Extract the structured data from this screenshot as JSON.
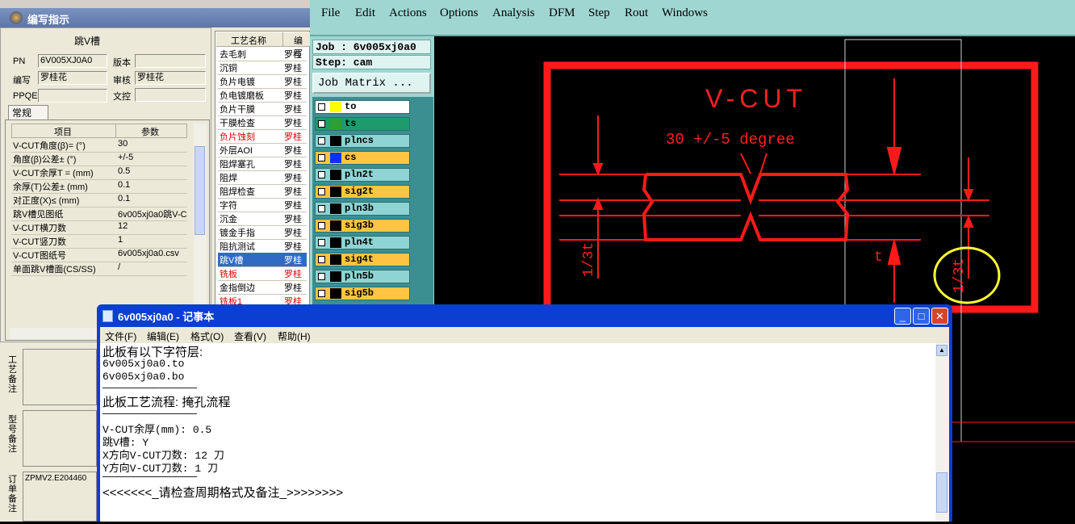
{
  "cam": {
    "menu": [
      "File",
      "Edit",
      "Actions",
      "Options",
      "Analysis",
      "DFM",
      "Step",
      "Rout",
      "Windows"
    ],
    "job_label": "Job : 6v005xj0a0",
    "step_label": "Step: cam",
    "job_matrix_button": "Job Matrix ...",
    "layers": [
      {
        "name": "to",
        "color": "#ffff00",
        "row_bg": "#ffffff"
      },
      {
        "name": "ts",
        "color": "#2fa02f",
        "row_bg": "#1f9a6c"
      },
      {
        "name": "plncs",
        "color": "#000000",
        "row_bg": "#8fd4d4"
      },
      {
        "name": "cs",
        "color": "#0033ff",
        "row_bg": "#ffc444"
      },
      {
        "name": "pln2t",
        "color": "#000000",
        "row_bg": "#8fd4d4"
      },
      {
        "name": "sig2t",
        "color": "#000000",
        "row_bg": "#ffc444"
      },
      {
        "name": "pln3b",
        "color": "#000000",
        "row_bg": "#8fd4d4"
      },
      {
        "name": "sig3b",
        "color": "#000000",
        "row_bg": "#ffc444"
      },
      {
        "name": "pln4t",
        "color": "#000000",
        "row_bg": "#8fd4d4"
      },
      {
        "name": "sig4t",
        "color": "#000000",
        "row_bg": "#ffc444"
      },
      {
        "name": "pln5b",
        "color": "#000000",
        "row_bg": "#8fd4d4"
      },
      {
        "name": "sig5b",
        "color": "#000000",
        "row_bg": "#ffc444"
      }
    ],
    "drawing": {
      "title": "V-CUT",
      "angle_note": "30 +/-5 degree",
      "dim_left": "1/3t",
      "dim_right": "1/3t",
      "dim_small": "t"
    }
  },
  "param_window": {
    "title": "编写指示",
    "group_title": "跳V槽",
    "pn_label": "PN",
    "pn_value": "6V005XJ0A0",
    "version_label": "版本",
    "version_value": "",
    "author_label": "编写",
    "author_value": "罗桂花",
    "reviewer_label": "审核",
    "reviewer_value": "罗桂花",
    "ppqe_label": "PPQE",
    "ppqe_value": "",
    "wencon_label": "文控",
    "wencon_value": "",
    "tab_label": "常规",
    "table_headers": [
      "项目",
      "参数"
    ],
    "table_rows": [
      [
        "V-CUT角度(β)=  (°)",
        "30"
      ],
      [
        "角度(β)公差±  (°)",
        "+/-5"
      ],
      [
        "V-CUT余厚T =  (mm)",
        "0.5"
      ],
      [
        "余厚(T)公差±  (mm)",
        "0.1"
      ],
      [
        "对正度(X)≤ (mm)",
        "0.1"
      ],
      [
        "跳V槽见图纸",
        "6v005xj0a0跳V-C"
      ],
      [
        "V-CUT横刀数",
        "12"
      ],
      [
        "V-CUT竖刀数",
        "1"
      ],
      [
        "V-CUT图纸号",
        "6v005xj0a0.csv"
      ],
      [
        "单面跳V槽面(CS/SS)",
        "/"
      ]
    ],
    "process_headers": [
      "工艺名称",
      "编写"
    ],
    "process_rows": [
      {
        "name": "去毛刺",
        "author": "罗桂",
        "red": false
      },
      {
        "name": "沉铜",
        "author": "罗桂",
        "red": false
      },
      {
        "name": "负片电镀",
        "author": "罗桂",
        "red": false
      },
      {
        "name": "负电镀磨板",
        "author": "罗桂",
        "red": false
      },
      {
        "name": "负片干膜",
        "author": "罗桂",
        "red": false
      },
      {
        "name": "干膜检查",
        "author": "罗桂",
        "red": false
      },
      {
        "name": "负片蚀刻",
        "author": "罗桂",
        "red": true
      },
      {
        "name": "外层AOI",
        "author": "罗桂",
        "red": false
      },
      {
        "name": "阻焊塞孔",
        "author": "罗桂",
        "red": false
      },
      {
        "name": "阻焊",
        "author": "罗桂",
        "red": false
      },
      {
        "name": "阻焊检查",
        "author": "罗桂",
        "red": false
      },
      {
        "name": "字符",
        "author": "罗桂",
        "red": false
      },
      {
        "name": "沉金",
        "author": "罗桂",
        "red": false
      },
      {
        "name": "镀金手指",
        "author": "罗桂",
        "red": false
      },
      {
        "name": "阻抗测试",
        "author": "罗桂",
        "red": false
      },
      {
        "name": "跳V槽",
        "author": "罗桂",
        "red": false,
        "selected": true
      },
      {
        "name": "铣板",
        "author": "罗桂",
        "red": true
      },
      {
        "name": "金指倒边",
        "author": "罗桂",
        "red": false
      },
      {
        "name": "铣板1",
        "author": "罗桂",
        "red": true
      }
    ],
    "side_notes": [
      "工艺备注",
      "型号备注",
      "订单备注"
    ],
    "order_note_value": "ZPMV2.E204460"
  },
  "notepad": {
    "title": "6v005xj0a0 - 记事本",
    "menu": [
      "文件(F)",
      "编辑(E)",
      "格式(O)",
      "查看(V)",
      "帮助(H)"
    ],
    "lines": [
      "此板有以下字符层:",
      "6v005xj0a0.to",
      "6v005xj0a0.bo",
      "———————————————",
      "此板工艺流程: 掩孔流程",
      "———————————————",
      "V-CUT余厚(mm): 0.5",
      "跳V槽: Y",
      "X方向V-CUT刀数: 12 刀",
      "Y方向V-CUT刀数: 1 刀",
      "———————————————",
      "<<<<<<<_请检查周期格式及备注_>>>>>>>>"
    ]
  }
}
